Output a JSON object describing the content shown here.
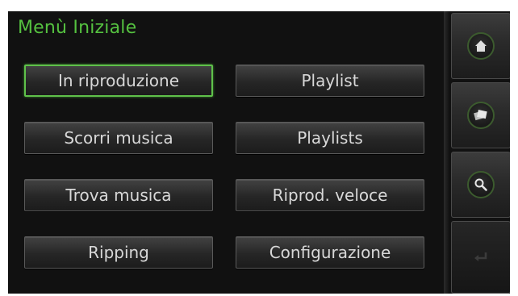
{
  "header": {
    "title": "Menù Iniziale"
  },
  "menu": {
    "buttons": [
      {
        "label": "In riproduzione",
        "selected": true
      },
      {
        "label": "Playlist",
        "selected": false
      },
      {
        "label": "Scorri musica",
        "selected": false
      },
      {
        "label": "Playlists",
        "selected": false
      },
      {
        "label": "Trova musica",
        "selected": false
      },
      {
        "label": "Riprod. veloce",
        "selected": false
      },
      {
        "label": "Ripping",
        "selected": false
      },
      {
        "label": "Configurazione",
        "selected": false
      }
    ]
  },
  "sidebar": {
    "items": [
      {
        "icon": "home-icon",
        "enabled": true
      },
      {
        "icon": "albums-icon",
        "enabled": true
      },
      {
        "icon": "search-icon",
        "enabled": true
      },
      {
        "icon": "back-icon",
        "enabled": false
      }
    ]
  },
  "colors": {
    "accent": "#55c140",
    "selected_border": "#5fc14a",
    "text": "#d8d8d8",
    "background": "#111111"
  }
}
